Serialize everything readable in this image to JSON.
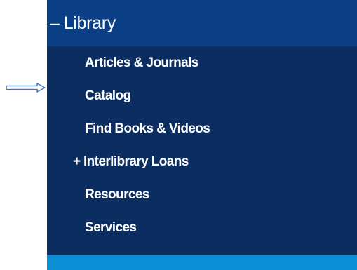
{
  "annotation": {
    "arrow_color": "#4472c4",
    "arrow_icon": "right-arrow-icon"
  },
  "nav": {
    "header": {
      "toggle": "–",
      "label": "Library",
      "background": "#0a3f86"
    },
    "background": "#0b2d5f",
    "text_color": "#ffffff",
    "footer_color": "#0a8fd4",
    "items": [
      {
        "label": "Articles & Journals",
        "prefix": ""
      },
      {
        "label": "Catalog",
        "prefix": ""
      },
      {
        "label": "Find Books & Videos",
        "prefix": ""
      },
      {
        "label": "Interlibrary Loans",
        "prefix": "+"
      },
      {
        "label": "Resources",
        "prefix": ""
      },
      {
        "label": "Services",
        "prefix": ""
      }
    ]
  }
}
